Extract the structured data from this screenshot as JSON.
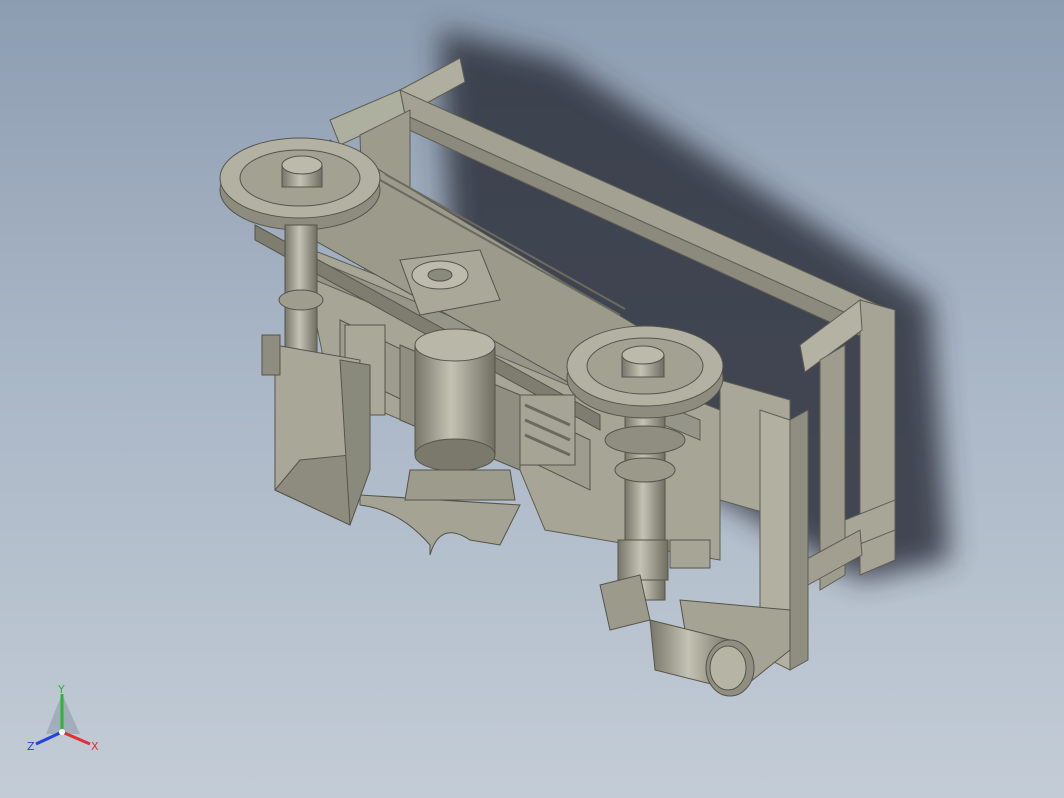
{
  "viewport": {
    "background_top": "#8d9db1",
    "background_bottom": "#c3ccd6",
    "model_color": "#a2a191",
    "model_shadow_color": "#2e333d"
  },
  "triad": {
    "x_label": "X",
    "y_label": "Y",
    "z_label": "Z",
    "x_color": "#e03030",
    "y_color": "#2fb33a",
    "z_color": "#2244dd"
  }
}
